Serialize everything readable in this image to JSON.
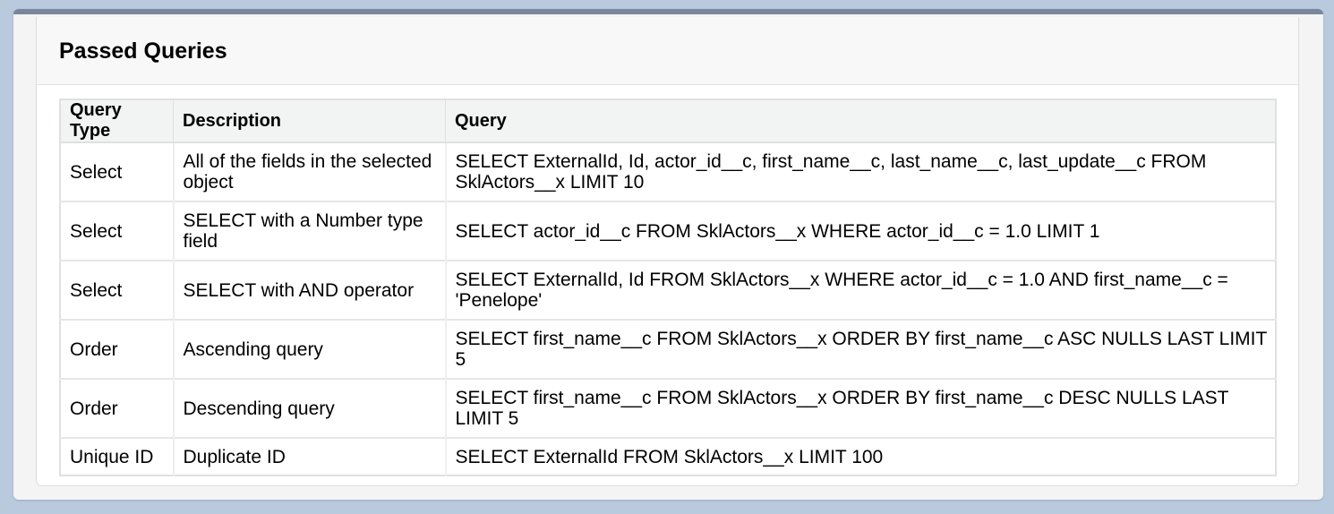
{
  "panel": {
    "title": "Passed Queries"
  },
  "table": {
    "headers": [
      "Query Type",
      "Description",
      "Query"
    ],
    "rows": [
      {
        "type": "Select",
        "description": "All of the fields in the selected object",
        "query": "SELECT ExternalId, Id, actor_id__c, first_name__c, last_name__c, last_update__c FROM SklActors__x LIMIT 10"
      },
      {
        "type": "Select",
        "description": "SELECT with a Number type field",
        "query": "SELECT actor_id__c FROM SklActors__x WHERE actor_id__c = 1.0 LIMIT 1"
      },
      {
        "type": "Select",
        "description": "SELECT with AND operator",
        "query": "SELECT ExternalId, Id FROM SklActors__x WHERE actor_id__c = 1.0 AND first_name__c = 'Penelope'"
      },
      {
        "type": "Order",
        "description": "Ascending query",
        "query": "SELECT first_name__c FROM SklActors__x ORDER BY first_name__c ASC NULLS LAST LIMIT 5"
      },
      {
        "type": "Order",
        "description": "Descending query",
        "query": "SELECT first_name__c FROM SklActors__x ORDER BY first_name__c DESC NULLS LAST LIMIT 5"
      },
      {
        "type": "Unique ID",
        "description": "Duplicate ID",
        "query": "SELECT ExternalId FROM SklActors__x LIMIT 100"
      }
    ]
  }
}
